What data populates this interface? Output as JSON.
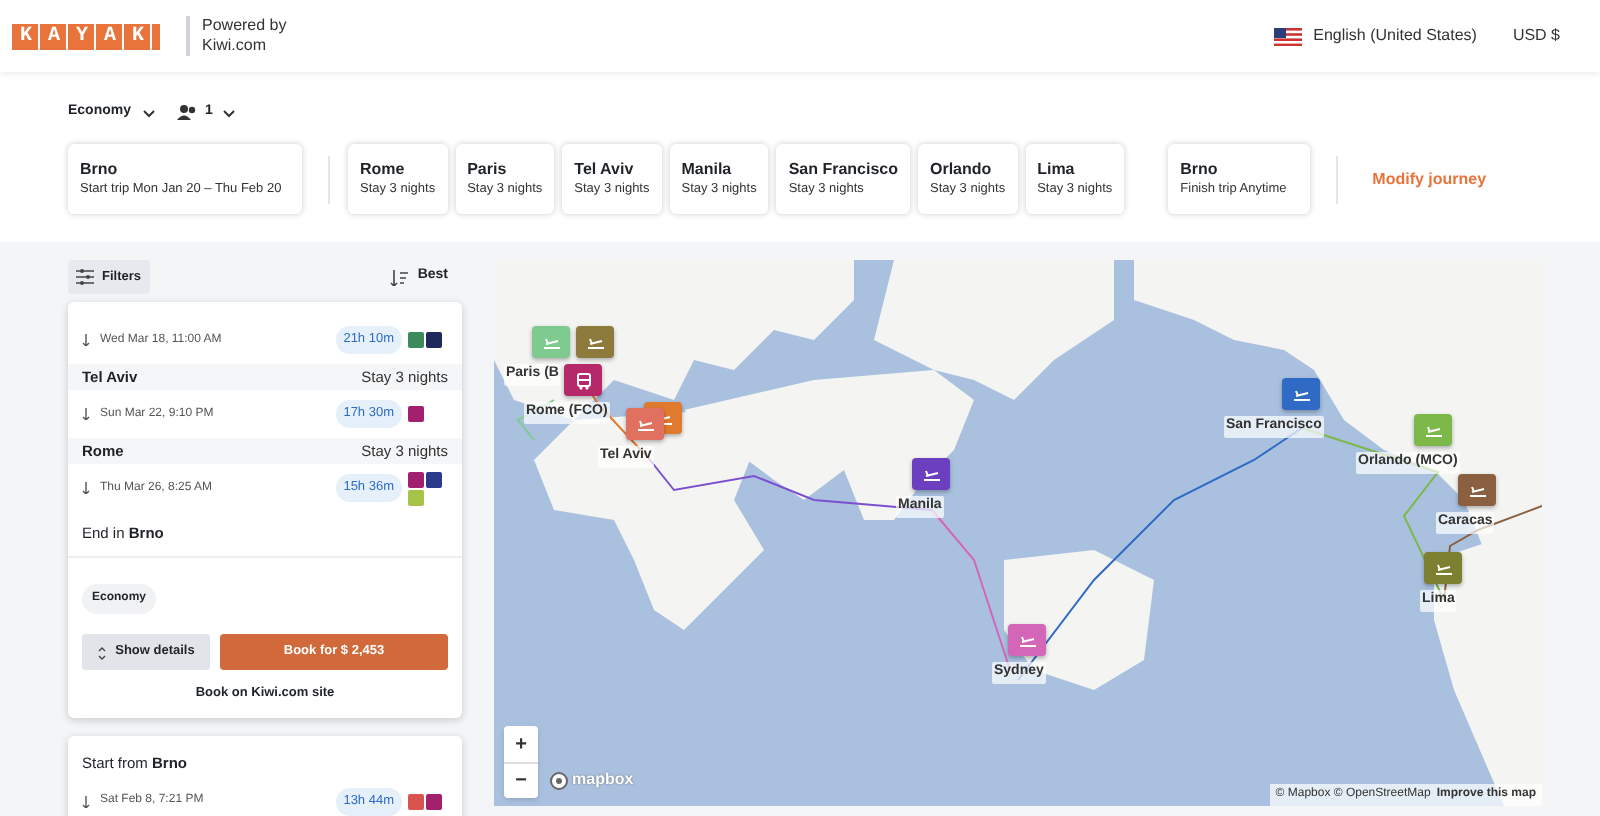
{
  "header": {
    "logo": "KAYAK",
    "powered_by": "Powered by",
    "partner": "Kiwi.com",
    "language": "English (United States)",
    "currency": "USD $"
  },
  "trip_options": {
    "cabin": "Economy",
    "passengers": "1"
  },
  "legs": [
    {
      "city": "Brno",
      "detail": "Start trip Mon Jan 20 – Thu Feb 20",
      "kind": "start"
    },
    {
      "city": "Rome",
      "detail": "Stay 3 nights",
      "kind": "stop"
    },
    {
      "city": "Paris",
      "detail": "Stay 3 nights",
      "kind": "stop"
    },
    {
      "city": "Tel Aviv",
      "detail": "Stay 3 nights",
      "kind": "stop"
    },
    {
      "city": "Manila",
      "detail": "Stay 3 nights",
      "kind": "stop"
    },
    {
      "city": "San Francisco",
      "detail": "Stay 3 nights",
      "kind": "stop"
    },
    {
      "city": "Orlando",
      "detail": "Stay 3 nights",
      "kind": "stop"
    },
    {
      "city": "Lima",
      "detail": "Stay 3 nights",
      "kind": "stop"
    },
    {
      "city": "Brno",
      "detail": "Finish trip Anytime",
      "kind": "end"
    }
  ],
  "modify_link": "Modify journey",
  "toolbar": {
    "filters": "Filters",
    "sort": "Best"
  },
  "result_card": {
    "rows": [
      {
        "kind": "flight",
        "date": "Wed Mar 18, 11:00 AM",
        "duration": "21h 10m",
        "airlines": [
          {
            "color": "#3a8a5c"
          },
          {
            "color": "#1f2a5c"
          }
        ]
      },
      {
        "kind": "stop",
        "city": "Tel Aviv",
        "stay": "Stay 3 nights"
      },
      {
        "kind": "flight",
        "date": "Sun Mar 22, 9:10 PM",
        "duration": "17h 30m",
        "airlines": [
          {
            "color": "#a3206e"
          }
        ]
      },
      {
        "kind": "stop",
        "city": "Rome",
        "stay": "Stay 3 nights"
      },
      {
        "kind": "flight",
        "date": "Thu Mar 26, 8:25 AM",
        "duration": "15h 36m",
        "airlines": [
          {
            "color": "#a3206e"
          },
          {
            "color": "#2b3a8c"
          },
          {
            "color": "#a6c34a"
          }
        ]
      },
      {
        "kind": "end",
        "text": "End in **Brno**"
      }
    ],
    "cabin": "Economy",
    "details_button": "Show details",
    "book_button": "Book for $ 2,453",
    "book_note": "Book on Kiwi.com site"
  },
  "next_card": {
    "start": "Start from **Brno**",
    "date": "Sat Feb 8, 7:21 PM",
    "duration": "13h 44m",
    "airlines": [
      {
        "color": "#d9534f"
      },
      {
        "color": "#a3206e"
      }
    ]
  },
  "map": {
    "markers": [
      {
        "kind": "plane",
        "color": "#7fcb8f",
        "label": "Paris (B"
      },
      {
        "kind": "plane",
        "color": "#8d7b3e"
      },
      {
        "kind": "bus",
        "color": "#b5286a",
        "label": "Rome (FCO)"
      },
      {
        "kind": "plane",
        "color": "#e07a2e"
      },
      {
        "kind": "plane",
        "color": "#e0705f",
        "label": "Tel Aviv"
      },
      {
        "kind": "plane",
        "color": "#6c3fc0",
        "label": "Manila"
      },
      {
        "kind": "plane",
        "color": "#d466b8",
        "label": "Sydney"
      },
      {
        "kind": "plane",
        "color": "#2f6bc4",
        "label": "San Francisco"
      },
      {
        "kind": "plane",
        "color": "#7cb84a",
        "label": "Orlando (MCO)"
      },
      {
        "kind": "plane",
        "color": "#8a6040",
        "label": "Caracas"
      },
      {
        "kind": "plane",
        "color": "#7d8030",
        "label": "Lima"
      }
    ],
    "zoom_in": "+",
    "zoom_out": "−",
    "brand": "mapbox",
    "attribution": "© Mapbox © OpenStreetMap",
    "improve_link": "Improve this map"
  }
}
